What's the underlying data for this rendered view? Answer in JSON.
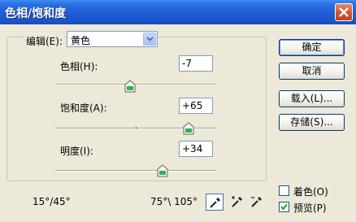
{
  "window": {
    "title": "色相/饱和度"
  },
  "edit": {
    "label": "编辑(E):",
    "selected": "黄色"
  },
  "hue": {
    "label": "色相(H):",
    "value": "-7",
    "level": -7
  },
  "saturation": {
    "label": "饱和度(A):",
    "value": "+65",
    "level": 65
  },
  "lightness": {
    "label": "明度(I):",
    "value": "+34",
    "level": 34
  },
  "buttons": {
    "ok": "确定",
    "cancel": "取消",
    "load": "载入(L)...",
    "save": "存储(S)..."
  },
  "options": {
    "colorize": {
      "label": "着色(O)",
      "checked": false
    },
    "preview": {
      "label": "预览(P)",
      "checked": true
    }
  },
  "range": {
    "left": "15°/45°",
    "right": "75°\\ 105°"
  }
}
